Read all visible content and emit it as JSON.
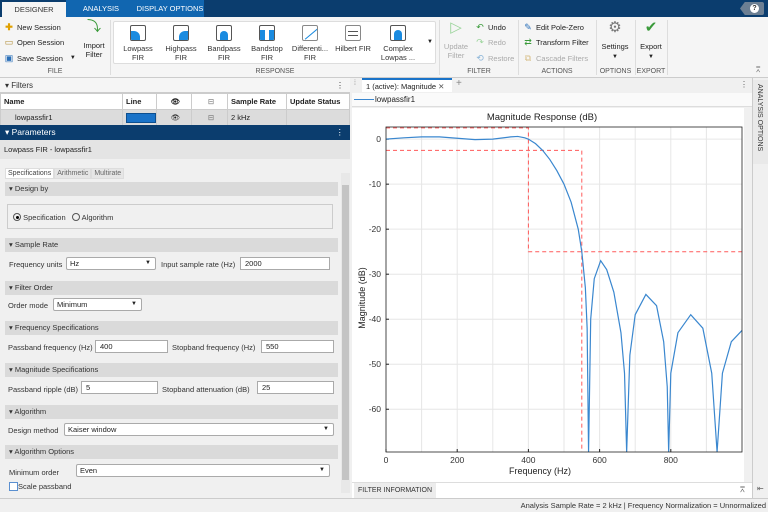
{
  "tabs": [
    "DESIGNER",
    "ANALYSIS",
    "DISPLAY OPTIONS"
  ],
  "help_label": "?",
  "toolstrip": {
    "file": {
      "label": "FILE",
      "new": "New Session",
      "open": "Open Session",
      "save": "Save Session",
      "import_l1": "Import",
      "import_l2": "Filter"
    },
    "response": {
      "label": "RESPONSE",
      "items": [
        [
          "Lowpass",
          "FIR"
        ],
        [
          "Highpass",
          "FIR"
        ],
        [
          "Bandpass",
          "FIR"
        ],
        [
          "Bandstop",
          "FIR"
        ],
        [
          "Differenti...",
          "FIR"
        ],
        [
          "Hilbert FIR",
          ""
        ],
        [
          "Complex",
          "Lowpas ..."
        ]
      ]
    },
    "filter": {
      "label": "FILTER",
      "update_l1": "Update",
      "update_l2": "Filter",
      "undo": "Undo",
      "redo": "Redo",
      "restore": "Restore"
    },
    "actions": {
      "label": "ACTIONS",
      "edit": "Edit Pole-Zero",
      "transform": "Transform Filter",
      "cascade": "Cascade Filters"
    },
    "options": {
      "label": "OPTIONS",
      "settings": "Settings"
    },
    "export": {
      "label": "EXPORT",
      "export": "Export"
    }
  },
  "filters": {
    "title": "Filters",
    "columns": [
      "Name",
      "Line",
      "",
      "",
      "Sample Rate",
      "Update Status"
    ],
    "rows": [
      {
        "name": "lowpassfir1",
        "line_color": "#1a73c8",
        "sample_rate": "2 kHz",
        "status": ""
      }
    ]
  },
  "parameters": {
    "title": "Parameters",
    "subtitle": "Lowpass FIR - lowpassfir1",
    "tabs": [
      "Specifications",
      "Arithmetic",
      "Multirate"
    ],
    "design_by": {
      "title": "Design by",
      "options": [
        "Specification",
        "Algorithm"
      ],
      "selected": "Specification"
    },
    "sample_rate": {
      "title": "Sample Rate",
      "units_label": "Frequency units",
      "units": "Hz",
      "rate_label": "Input sample rate (Hz)",
      "rate": "2000"
    },
    "filter_order": {
      "title": "Filter Order",
      "mode_label": "Order mode",
      "mode": "Minimum"
    },
    "freq_specs": {
      "title": "Frequency Specifications",
      "pass_label": "Passband frequency (Hz)",
      "pass": "400",
      "stop_label": "Stopband frequency (Hz)",
      "stop": "550"
    },
    "mag_specs": {
      "title": "Magnitude Specifications",
      "ripple_label": "Passband ripple (dB)",
      "ripple": "5",
      "atten_label": "Stopband attenuation (dB)",
      "atten": "25"
    },
    "algorithm": {
      "title": "Algorithm",
      "method_label": "Design method",
      "method": "Kaiser window"
    },
    "algo_options": {
      "title": "Algorithm Options",
      "min_order_label": "Minimum order",
      "min_order": "Even",
      "scale_label": "Scale passband",
      "scale_checked": false
    }
  },
  "analysis": {
    "tab": "1 (active): Magnitude",
    "legend": "lowpassfir1",
    "filter_info": "FILTER INFORMATION",
    "side_tab": "ANALYSIS OPTIONS"
  },
  "status": "Analysis Sample Rate = 2 kHz | Frequency Normalization = Unnormalized",
  "chart_data": {
    "type": "line",
    "title": "Magnitude Response (dB)",
    "xlabel": "Frequency (Hz)",
    "ylabel": "Magnitude (dB)",
    "xlim": [
      0,
      1000
    ],
    "ylim": [
      -69.5,
      2.7
    ],
    "grid": true,
    "xticks": [
      0,
      200,
      400,
      600,
      800
    ],
    "yticks": [
      0,
      -10,
      -20,
      -30,
      -40,
      -50,
      -60
    ],
    "series": [
      {
        "name": "lowpassfir1",
        "color": "#3a87cf",
        "x": [
          0,
          50,
          100,
          150,
          200,
          250,
          300,
          350,
          370,
          390,
          400,
          420,
          440,
          460,
          480,
          500,
          520,
          540,
          550,
          560,
          565,
          569,
          575,
          585,
          603,
          620,
          640,
          660,
          670,
          676,
          685,
          700,
          730,
          760,
          780,
          790,
          794,
          800,
          820,
          856,
          890,
          915,
          930,
          945,
          970,
          1000
        ],
        "y": [
          0,
          0.3,
          0.5,
          0.5,
          0.2,
          -0.1,
          0,
          0.5,
          0.6,
          0.3,
          0,
          -1,
          -2.5,
          -4.5,
          -7,
          -10,
          -14,
          -20,
          -25,
          -33,
          -42,
          -69.5,
          -40,
          -31,
          -27,
          -29,
          -34,
          -43,
          -52,
          -69.5,
          -48,
          -39,
          -34.5,
          -37,
          -45,
          -55,
          -69.5,
          -52,
          -43,
          -39,
          -42,
          -52,
          -69.5,
          -52,
          -45,
          -42.5
        ]
      }
    ],
    "mask": {
      "color": "#ff5a5a",
      "passband_upper": 2.5,
      "passband_lower": -2.5,
      "passband_edge": 400,
      "stopband_edge": 550,
      "stopband_level": -25
    }
  }
}
